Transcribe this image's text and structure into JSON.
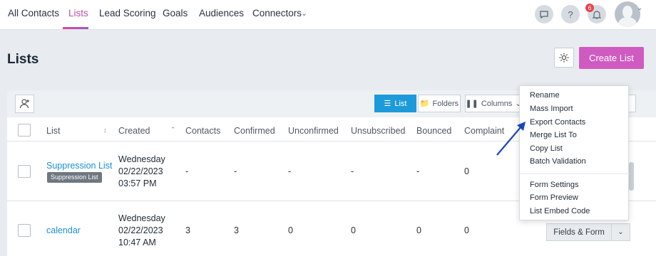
{
  "nav": {
    "tabs": [
      {
        "label": "All Contacts"
      },
      {
        "label": "Lists"
      },
      {
        "label": "Lead Scoring"
      },
      {
        "label": "Goals"
      },
      {
        "label": "Audiences"
      },
      {
        "label": "Connectors"
      }
    ],
    "icons": [
      "chat-icon",
      "help-icon",
      "bell-icon"
    ],
    "notification_count": "6",
    "colors": {
      "active_tab": "#c04fa5",
      "primary": "#cf5bc0",
      "link": "#1b8fd1",
      "list_toggle": "#1d9ad9"
    }
  },
  "header": {
    "title": "Lists",
    "create_label": "Create List"
  },
  "toolbar": {
    "list_label": "List",
    "folders_label": "Folders",
    "columns_label": "Columns"
  },
  "table": {
    "columns": [
      "List",
      "Created",
      "Contacts",
      "Confirmed",
      "Unconfirmed",
      "Unsubscribed",
      "Bounced",
      "Complaint"
    ],
    "rows": [
      {
        "name": "Suppression List",
        "badge": "Suppression List",
        "created": [
          "Wednesday",
          "02/22/2023",
          "03:57 PM"
        ],
        "contacts": "-",
        "confirmed": "-",
        "unconfirmed": "-",
        "unsubscribed": "-",
        "bounced": "-",
        "complaint": "0"
      },
      {
        "name": "calendar",
        "created": [
          "Wednesday",
          "02/22/2023",
          "10:47 AM"
        ],
        "contacts": "3",
        "confirmed": "3",
        "unconfirmed": "0",
        "unsubscribed": "0",
        "bounced": "0",
        "complaint": "0",
        "action_label": "Fields & Form"
      }
    ]
  },
  "menu": {
    "items": [
      "Rename",
      "Mass Import",
      "Export Contacts",
      "Merge List To",
      "Copy List",
      "Batch Validation",
      "Form Settings",
      "Form Preview",
      "List Embed Code"
    ]
  }
}
